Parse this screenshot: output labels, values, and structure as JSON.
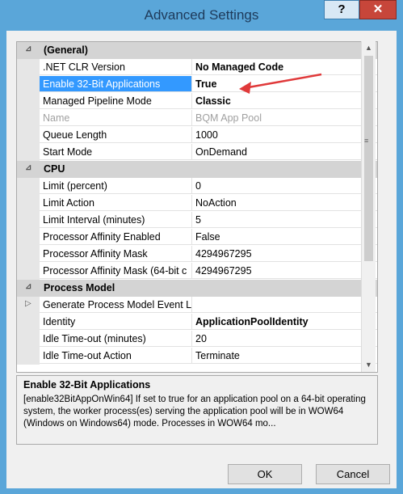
{
  "window": {
    "title": "Advanced Settings",
    "help_label": "?",
    "close_label": "✕"
  },
  "grid": {
    "categories": [
      {
        "label": "(General)",
        "caret": "⊿"
      },
      {
        "label": "CPU",
        "caret": "⊿"
      },
      {
        "label": "Process Model",
        "caret": "⊿"
      }
    ],
    "rows": [
      {
        "name": ".NET CLR Version",
        "value": "No Managed Code"
      },
      {
        "name": "Enable 32-Bit Applications",
        "value": "True"
      },
      {
        "name": "Managed Pipeline Mode",
        "value": "Classic"
      },
      {
        "name": "Name",
        "value": "BQM App Pool"
      },
      {
        "name": "Queue Length",
        "value": "1000"
      },
      {
        "name": "Start Mode",
        "value": "OnDemand"
      },
      {
        "name": "Limit (percent)",
        "value": "0"
      },
      {
        "name": "Limit Action",
        "value": "NoAction"
      },
      {
        "name": "Limit Interval (minutes)",
        "value": "5"
      },
      {
        "name": "Processor Affinity Enabled",
        "value": "False"
      },
      {
        "name": "Processor Affinity Mask",
        "value": "4294967295"
      },
      {
        "name": "Processor Affinity Mask (64-bit c",
        "value": "4294967295"
      },
      {
        "name": "Generate Process Model Event L",
        "value": "",
        "expander": "▷"
      },
      {
        "name": "Identity",
        "value": "ApplicationPoolIdentity"
      },
      {
        "name": "Idle Time-out (minutes)",
        "value": "20"
      },
      {
        "name": "Idle Time-out Action",
        "value": "Terminate"
      }
    ]
  },
  "description": {
    "title": "Enable 32-Bit Applications",
    "text": "[enable32BitAppOnWin64] If set to true for an application pool on a 64-bit operating system, the worker process(es) serving the application pool will be in WOW64 (Windows on Windows64) mode. Processes in WOW64 mo..."
  },
  "buttons": {
    "ok": "OK",
    "cancel": "Cancel"
  },
  "icons": {
    "dropdown": "chevron-down-icon",
    "scroll_up": "▲",
    "scroll_down": "▼",
    "grip": "≡"
  },
  "colors": {
    "selection": "#3399ff",
    "arrow": "#e0393a",
    "close": "#c7463a"
  }
}
